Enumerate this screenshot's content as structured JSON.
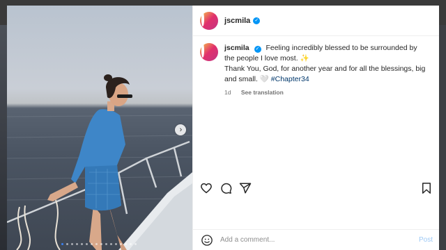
{
  "post": {
    "username": "jscmila",
    "verified": true,
    "caption": {
      "username": "jscmila",
      "line1": "Feeling incredibly blessed to be surrounded by the people I love most.",
      "sparkle_emoji": "✨",
      "line2": "Thank You, God, for another year and for all the blessings, big and small.",
      "heart_emoji": "🤍",
      "hashtag": "#Chapter34"
    },
    "time_ago": "1d",
    "see_translation": "See translation"
  },
  "media": {
    "carousel_total": 16,
    "carousel_active": 0
  },
  "actions": {
    "icons": [
      "heart-icon",
      "comment-icon",
      "share-icon",
      "bookmark-icon"
    ]
  },
  "comment_box": {
    "placeholder": "Add a comment...",
    "post_label": "Post"
  },
  "colors": {
    "accent": "#0095f6",
    "hashtag": "#00376b",
    "post_disabled": "#9dc9f5"
  }
}
